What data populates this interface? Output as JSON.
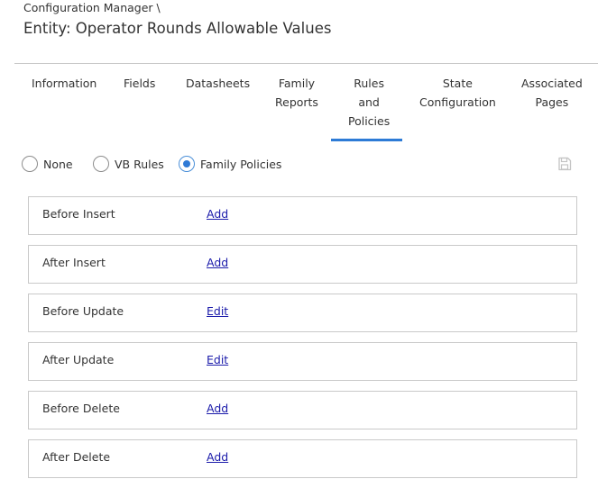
{
  "header": {
    "breadcrumb": "Configuration Manager \\",
    "title": "Entity: Operator Rounds Allowable Values"
  },
  "tabs": [
    {
      "label": "Information"
    },
    {
      "label": "Fields"
    },
    {
      "label": "Datasheets"
    },
    {
      "label": "Family\nReports"
    },
    {
      "label": "Rules\nand\nPolicies",
      "active": true
    },
    {
      "label": "State\nConfiguration"
    },
    {
      "label": "Associated\nPages"
    }
  ],
  "options": {
    "items": [
      {
        "label": "None",
        "checked": false
      },
      {
        "label": "VB Rules",
        "checked": false
      },
      {
        "label": "Family Policies",
        "checked": true
      }
    ],
    "save_icon": "save-icon"
  },
  "rules": [
    {
      "label": "Before Insert",
      "action": "Add"
    },
    {
      "label": "After Insert",
      "action": "Add"
    },
    {
      "label": "Before Update",
      "action": "Edit"
    },
    {
      "label": "After Update",
      "action": "Edit"
    },
    {
      "label": "Before Delete",
      "action": "Add"
    },
    {
      "label": "After Delete",
      "action": "Add"
    }
  ],
  "colors": {
    "accent": "#2d7bd6",
    "link": "#1a1aaa",
    "border": "#c9c9c9"
  }
}
